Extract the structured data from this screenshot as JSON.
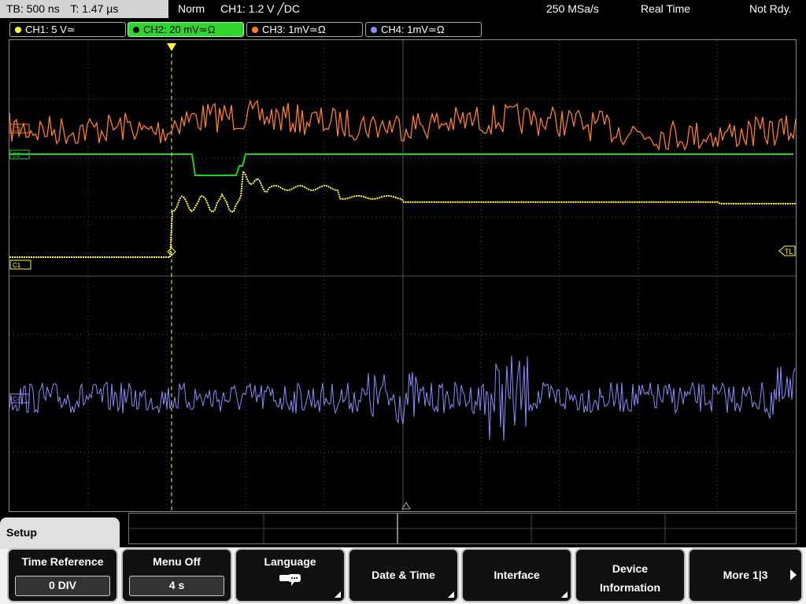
{
  "status_bar": {
    "timebase": "TB: 500 ns",
    "trigger_time": "T: 1.47 µs",
    "mode": "Norm",
    "trigger": "CH1: 1.2 V ╱DC",
    "sample_rate": "250 MSa/s",
    "acq_mode": "Real Time",
    "state": "Not Rdy."
  },
  "channels": [
    {
      "label": "CH1: 5 V≃",
      "color": "#ffff33"
    },
    {
      "label": "CH2: 20 mV≃Ω",
      "color": "#1ed21e"
    },
    {
      "label": "CH3: 1mV≃Ω",
      "color": "#ff7f27"
    },
    {
      "label": "CH4: 1mV≃Ω",
      "color": "#8c8cff"
    }
  ],
  "markers": {
    "ch1": "C1",
    "ch2": "C2",
    "ch3": "C3",
    "ch4": "C4",
    "trigger_level": "TL"
  },
  "menu": {
    "title": "Setup",
    "softkeys": [
      {
        "label": "Time Reference",
        "value": "0 DIV"
      },
      {
        "label": "Menu Off",
        "value": "4 s"
      },
      {
        "label": "Language",
        "icon": "speech-bubble-icon"
      },
      {
        "label": "Date & Time"
      },
      {
        "label": "Interface"
      },
      {
        "label": "Device",
        "label2": "Information"
      },
      {
        "label": "More 1|3"
      }
    ]
  },
  "colors": {
    "grid": "#555555",
    "panel": "#f2f2f2"
  }
}
